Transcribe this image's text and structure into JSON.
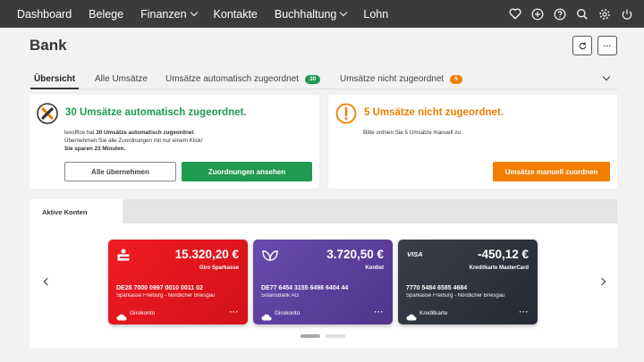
{
  "nav": {
    "items": [
      {
        "label": "Dashboard"
      },
      {
        "label": "Belege"
      },
      {
        "label": "Finanzen"
      },
      {
        "label": "Kontakte"
      },
      {
        "label": "Buchhaltung"
      },
      {
        "label": "Lohn"
      }
    ],
    "icons": [
      "heart-icon",
      "plus-circle-icon",
      "help-icon",
      "search-icon",
      "gear-icon",
      "power-icon"
    ]
  },
  "page": {
    "title": "Bank",
    "buttons": [
      "refresh-icon",
      "more-icon"
    ]
  },
  "tabs": [
    {
      "label": "Übersicht",
      "active": true
    },
    {
      "label": "Alle Umsätze"
    },
    {
      "label": "Umsätze automatisch zugeordnet",
      "badge": "30",
      "badge_color": "#1f9a4f"
    },
    {
      "label": "Umsätze nicht zugeordnet",
      "badge": "5",
      "badge_color": "#f07d00"
    }
  ],
  "card_auto": {
    "title": "30 Umsätze automatisch zugeordnet.",
    "title_color": "#1f9a4f",
    "line1_prefix": "lexoffice hat ",
    "line1_bold": "30 Umsätze automatisch zugeordnet",
    "line1_suffix": ".",
    "line2": "Übernehmen Sie alle Zuordnungen mit nur einem Klick!",
    "line3": "Sie sparen 23 Minuten.",
    "btn_secondary": "Alle übernehmen",
    "btn_primary": "Zuordnungen ansehen",
    "btn_primary_color": "#1f9a4f"
  },
  "card_manual": {
    "title": "5 Umsätze nicht zugeordnet.",
    "title_color": "#f07d00",
    "text": "Bitte ordnen Sie 5 Umsätze manuell zu.",
    "btn_primary": "Umsätze manuell zuordnen",
    "btn_primary_color": "#f07d00"
  },
  "accounts": {
    "tab_label": "Aktive Konten",
    "cards": [
      {
        "amount": "15.320,20 €",
        "name": "Giro Sparkasse",
        "iban": "DE28 7000 0997 0010 0011 02",
        "bank": "Sparkasse Freiburg - Nördlicher Breisgau",
        "type": "Girokonto",
        "logo": "sparkasse-logo",
        "color": "#e3141c"
      },
      {
        "amount": "3.720,50 €",
        "name": "Kontist",
        "iban": "DE77 6454 3155 6498 6404 44",
        "bank": "SolarisBank AG",
        "type": "Girokonto",
        "logo": "kontist-leaf-logo",
        "color": "#5b3e9c"
      },
      {
        "amount": "-450,12 €",
        "name": "Kreditkarte MasterCard",
        "iban": "7770 5484 6585 4684",
        "bank": "Sparkasse Freiburg - Nördlicher Breisgau",
        "type": "Kreditkarte",
        "logo": "VISA",
        "color": "#2e3340"
      }
    ],
    "page_dots": 2,
    "active_page": 1
  }
}
